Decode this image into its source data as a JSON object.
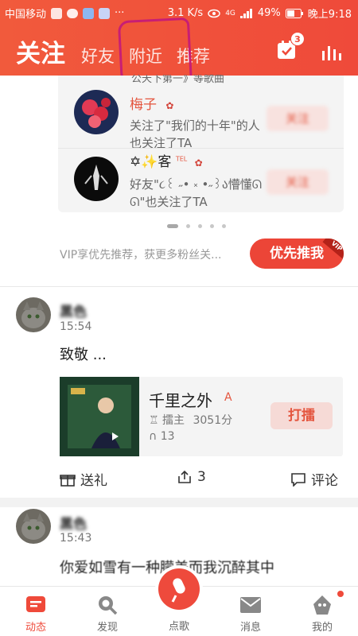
{
  "status_bar": {
    "carrier": "中国移动",
    "more": "···",
    "speed": "3.1 K/s",
    "network": "4G",
    "battery": "49%",
    "time": "晚上9:18"
  },
  "header": {
    "tabs": [
      {
        "label": "关注",
        "active": true
      },
      {
        "label": "好友",
        "active": false
      },
      {
        "label": "附近",
        "active": false
      },
      {
        "label": "推荐",
        "active": false
      }
    ],
    "calendar_badge": "3",
    "accent": "#ef4a3a"
  },
  "recommend": {
    "cut_text": "公天下第一》等歌曲",
    "items": [
      {
        "name": "梅子",
        "desc": "关注了\"我们的十年\"的人也关注了TA",
        "button": "关注"
      },
      {
        "name": "✡✨客",
        "tel": "TEL",
        "desc_line1": "好友\"૮꒰ ˶• ༝ •˶꒱ა懵懂ᘏ",
        "desc_line2": "ᘏ\"也关注了TA",
        "button": "关注"
      }
    ],
    "dot_count": 5,
    "active_dot": 0,
    "vip_text": "VIP享优先推荐，获更多粉丝关...",
    "vip_button": "优先推我",
    "vip_tag": "VIP"
  },
  "posts": [
    {
      "name": "黑色",
      "time": "15:54",
      "text": "致敬 ...",
      "song": {
        "title": "千里之外",
        "a_mark": "A",
        "host_label": "擂主",
        "host_score": "3051分",
        "plays": "13",
        "sing_button": "打擂"
      },
      "actions": {
        "gift": "送礼",
        "share_count": "3",
        "comment": "评论"
      }
    },
    {
      "name": "黑色",
      "time": "15:43",
      "text": "你爱如雪有一种朦美而我沉醉其中"
    }
  ],
  "bottom_nav": {
    "items": [
      {
        "label": "动态",
        "icon": "feed-icon",
        "active": true
      },
      {
        "label": "发现",
        "icon": "discover-icon",
        "active": false
      },
      {
        "label": "点歌",
        "icon": "sing-icon",
        "active": false
      },
      {
        "label": "消息",
        "icon": "message-icon",
        "active": false
      },
      {
        "label": "我的",
        "icon": "profile-icon",
        "active": false
      }
    ]
  }
}
